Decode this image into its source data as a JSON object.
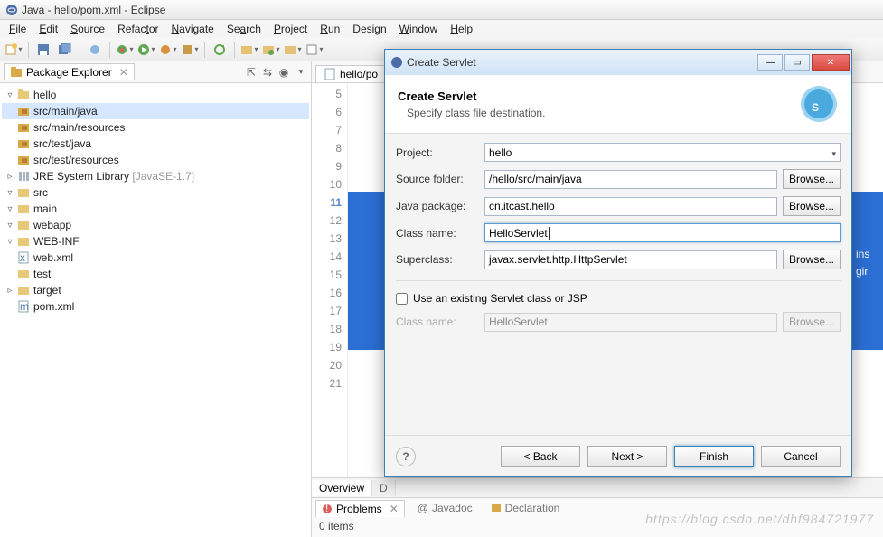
{
  "window": {
    "title": "Java - hello/pom.xml - Eclipse"
  },
  "menus": [
    "File",
    "Edit",
    "Source",
    "Refactor",
    "Navigate",
    "Search",
    "Project",
    "Run",
    "Design",
    "Window",
    "Help"
  ],
  "sidebar": {
    "tab": "Package Explorer",
    "tree": {
      "root": "hello",
      "srcMainJava": "src/main/java",
      "srcMainRes": "src/main/resources",
      "srcTestJava": "src/test/java",
      "srcTestRes": "src/test/resources",
      "jre": "JRE System Library",
      "jreVer": "[JavaSE-1.7]",
      "src": "src",
      "main": "main",
      "webapp": "webapp",
      "webinf": "WEB-INF",
      "webxml": "web.xml",
      "test": "test",
      "target": "target",
      "pom": "pom.xml"
    }
  },
  "editor": {
    "tab": "hello/po",
    "lines": [
      "5",
      "6",
      "7",
      "8",
      "9",
      "10",
      "11",
      "12",
      "13",
      "14",
      "15",
      "16",
      "17",
      "18",
      "19",
      "20",
      "21"
    ],
    "currentLine": "11",
    "bottomTabs": [
      "Overview",
      "D"
    ],
    "hint1": "ins",
    "hint2": "gir"
  },
  "problems": {
    "tabs": [
      "Problems",
      "Javadoc",
      "Declaration"
    ],
    "status": "0 items"
  },
  "dialog": {
    "title": "Create Servlet",
    "header": {
      "title": "Create Servlet",
      "subtitle": "Specify class file destination."
    },
    "labels": {
      "project": "Project:",
      "sourceFolder": "Source folder:",
      "javaPackage": "Java package:",
      "className": "Class name:",
      "superclass": "Superclass:",
      "useExisting": "Use an existing Servlet class or JSP",
      "className2": "Class name:"
    },
    "values": {
      "project": "hello",
      "sourceFolder": "/hello/src/main/java",
      "javaPackage": "cn.itcast.hello",
      "className": "HelloServlet",
      "superclass": "javax.servlet.http.HttpServlet",
      "className2": "HelloServlet"
    },
    "buttons": {
      "browse": "Browse...",
      "back": "< Back",
      "next": "Next >",
      "finish": "Finish",
      "cancel": "Cancel"
    }
  },
  "watermark": "https://blog.csdn.net/dhf984721977"
}
